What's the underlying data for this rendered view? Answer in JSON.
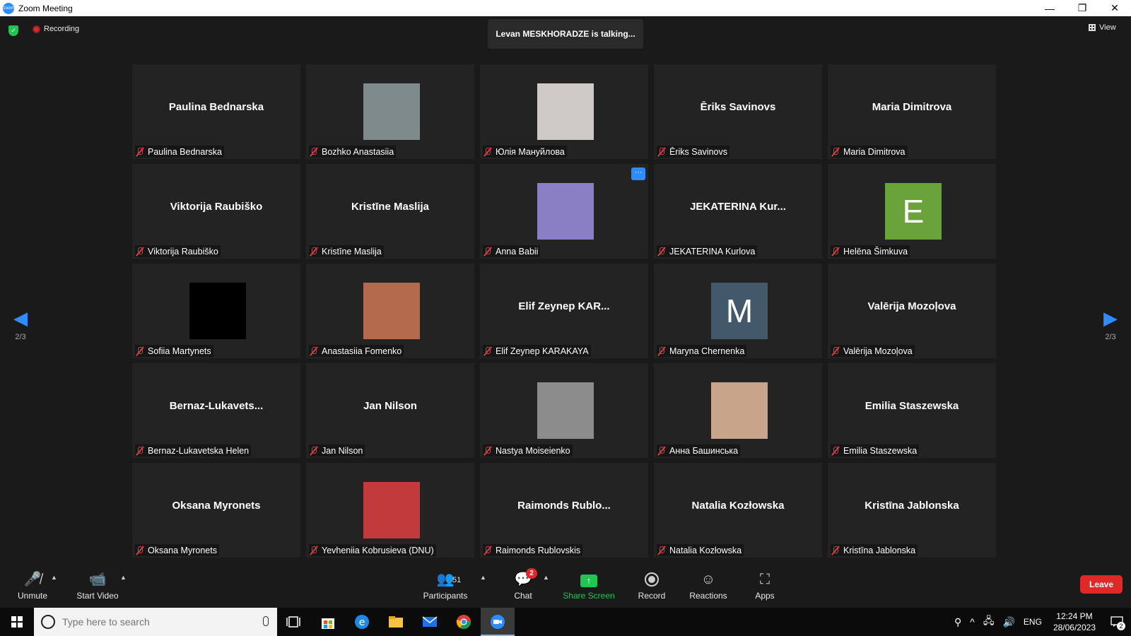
{
  "window": {
    "title": "Zoom Meeting",
    "minimize": "—",
    "restore": "❐",
    "close": "✕"
  },
  "top": {
    "recording": "Recording",
    "talking": "Levan MESKHORADZE is talking...",
    "view": "View"
  },
  "pager": {
    "left": "2/3",
    "right": "2/3"
  },
  "tiles": [
    {
      "big": "Paulina Bednarska",
      "label": "Paulina Bednarska"
    },
    {
      "photo": "#7f8a8c",
      "label": "Bozhko Anastasiia"
    },
    {
      "photo": "#cfcac6",
      "label": "Юлія Мануйлова"
    },
    {
      "big": "Ēriks Savinovs",
      "label": "Ēriks Savinovs"
    },
    {
      "big": "Maria Dimitrova",
      "label": "Maria Dimitrova"
    },
    {
      "big": "Viktorija Raubiško",
      "label": "Viktorija Raubiško"
    },
    {
      "big": "Kristīne Maslija",
      "label": "Kristīne Maslija"
    },
    {
      "photo": "#8a7fc4",
      "label": "Anna Babii",
      "more": "···"
    },
    {
      "big": "JEKATERINA  Kur...",
      "label": "JEKATERINA Kurlova"
    },
    {
      "initial": "E",
      "initial_color": "#6aa33a",
      "label": "Helēna Šimkuva"
    },
    {
      "photo": "#000000",
      "label": "Sofiia Martynets"
    },
    {
      "photo": "#b36a4d",
      "label": "Anastasiia Fomenko"
    },
    {
      "big": "Elif  Zeynep  KAR...",
      "label": "Elif Zeynep KARAKAYA"
    },
    {
      "initial": "M",
      "initial_color": "#435868",
      "label": "Maryna Chernenka"
    },
    {
      "big": "Valērija Mozoļova",
      "label": "Valērija Mozoļova"
    },
    {
      "big": "Bernaz-Lukavets...",
      "label": "Bernaz-Lukavetska Helen"
    },
    {
      "big": "Jan Nilson",
      "label": "Jan Nilson"
    },
    {
      "photo": "#8c8c8c",
      "label": "Nastya Moiseienko"
    },
    {
      "photo": "#c8a58a",
      "label": "Анна Башинська"
    },
    {
      "big": "Emilia Staszewska",
      "label": "Emilia Staszewska"
    },
    {
      "big": "Oksana Myronets",
      "label": "Oksana Myronets"
    },
    {
      "photo": "#c23a3a",
      "label": "Yevheniia Kobrusieva (DNU)"
    },
    {
      "big": "Raimonds  Rublo...",
      "label": "Raimonds Rublovskis"
    },
    {
      "big": "Natalia Kozłowska",
      "label": "Natalia Kozłowska"
    },
    {
      "big": "Kristīna Jablonska",
      "label": "Kristīna Jablonska"
    }
  ],
  "toolbar": {
    "unmute": "Unmute",
    "start_video": "Start Video",
    "participants": "Participants",
    "participants_count": "51",
    "chat": "Chat",
    "chat_badge": "2",
    "share_screen": "Share Screen",
    "record": "Record",
    "reactions": "Reactions",
    "apps": "Apps",
    "leave": "Leave"
  },
  "taskbar": {
    "search_placeholder": "Type here to search",
    "lang": "ENG",
    "time": "12:24 PM",
    "date": "28/06/2023",
    "notif_count": "2"
  },
  "colors": {
    "accent": "#2d8cff",
    "danger": "#e02828",
    "share": "#23c552"
  }
}
